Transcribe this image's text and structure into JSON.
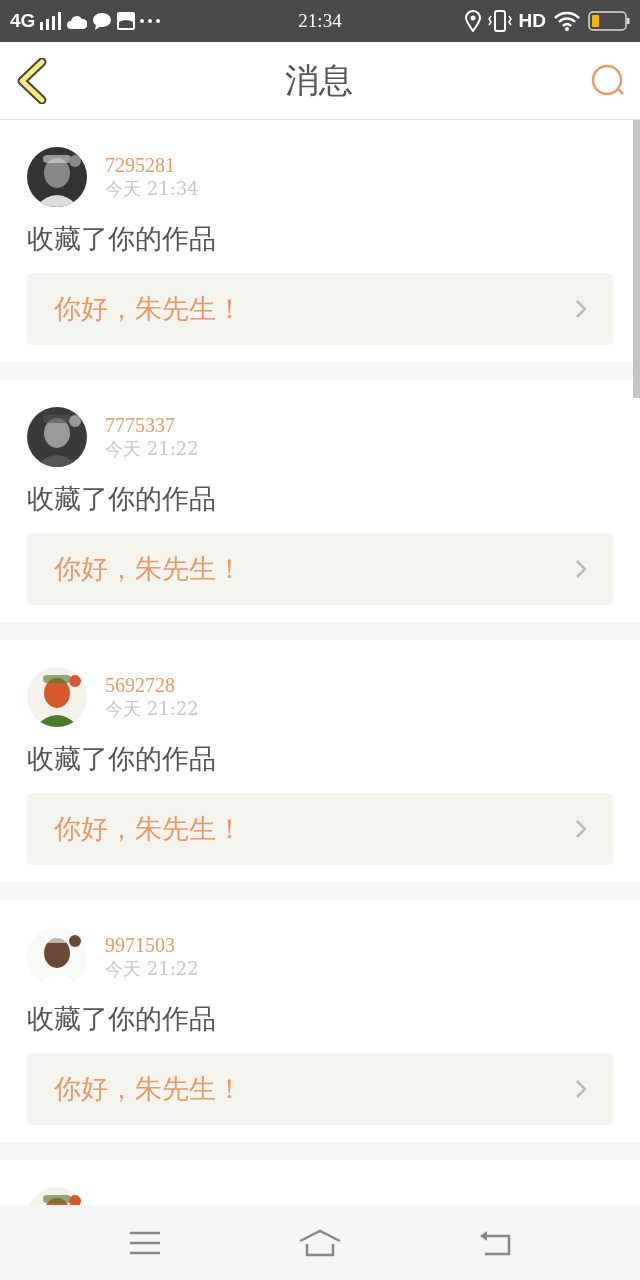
{
  "status_bar": {
    "network": "4G",
    "time": "21:34",
    "hd": "HD"
  },
  "header": {
    "title": "消息"
  },
  "messages": [
    {
      "user": "7295281",
      "time": "今天 21:34",
      "action": "收藏了你的作品",
      "preview": "你好，朱先生！"
    },
    {
      "user": "7775337",
      "time": "今天 21:22",
      "action": "收藏了你的作品",
      "preview": "你好，朱先生！"
    },
    {
      "user": "5692728",
      "time": "今天 21:22",
      "action": "收藏了你的作品",
      "preview": "你好，朱先生！"
    },
    {
      "user": "9971503",
      "time": "今天 21:22",
      "action": "收藏了你的作品",
      "preview": "你好，朱先生！"
    }
  ]
}
